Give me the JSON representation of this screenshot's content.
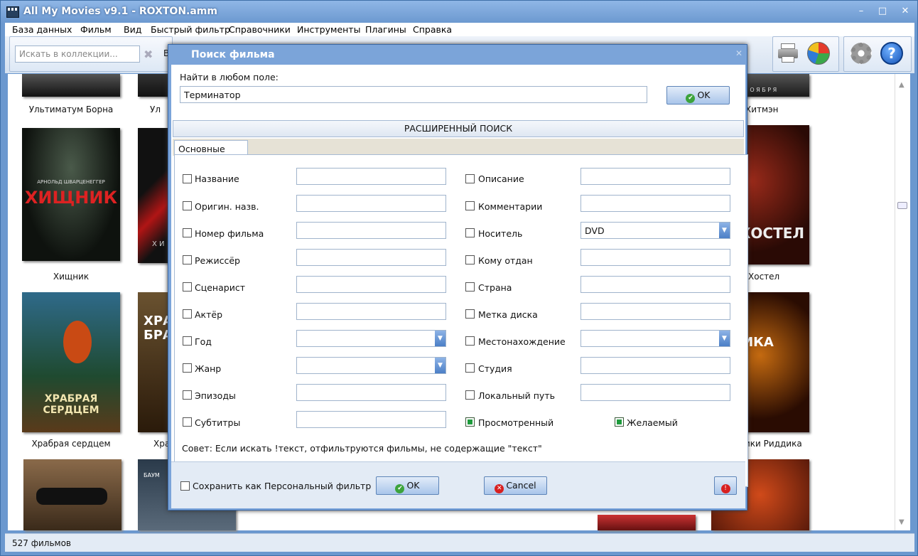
{
  "app": {
    "title": "All My Movies v9.1 - ROXTON.amm"
  },
  "window_controls": {
    "minimize": "–",
    "maximize": "□",
    "close": "✕"
  },
  "menu": [
    "База данных",
    "Фильм",
    "Вид",
    "Быстрый фильтр",
    "Справочники",
    "Инструменты",
    "Плагины",
    "Справка"
  ],
  "toolbar": {
    "search_placeholder": "Искать в коллекции...",
    "partial_label": "В"
  },
  "gallery": {
    "titles_row0": [
      "Ультиматум Борна",
      "Ул",
      "Хитмэн"
    ],
    "titles_row1": [
      "Хищник",
      "Хостел"
    ],
    "titles_row2": [
      "Храбрая сердцем",
      "Хра",
      "ики Риддика"
    ],
    "poster_text": {
      "p1a": "АРНОЛЬД ШВАРЦЕНЕГГЕР",
      "p1b": "ХИЩНИК",
      "p2": "Х И",
      "p3a": "ХРАБРАЯ",
      "p3b": "СЕРДЦЕМ",
      "p4a": "ХРА",
      "p4b": "БРА",
      "p5": "ХОСТЕЛ",
      "p6": "ДДИКА",
      "p7": "Н О Я Б Р Я",
      "p8": "БАУМ"
    }
  },
  "status": {
    "count": "527 фильмов"
  },
  "dialog": {
    "title": "Поиск фильма",
    "any_field_label": "Найти в любом поле:",
    "any_field_value": "Терминатор",
    "ok": "OK",
    "advanced": "РАСШИРЕННЫЙ ПОИСК",
    "tab": "Основные поля",
    "left_fields": [
      {
        "label": "Название",
        "checked": false,
        "type": "text",
        "value": ""
      },
      {
        "label": "Оригин. назв.",
        "checked": false,
        "type": "text",
        "value": ""
      },
      {
        "label": "Номер фильма",
        "checked": false,
        "type": "text",
        "value": ""
      },
      {
        "label": "Режиссёр",
        "checked": false,
        "type": "text",
        "value": ""
      },
      {
        "label": "Сценарист",
        "checked": false,
        "type": "text",
        "value": ""
      },
      {
        "label": "Актёр",
        "checked": false,
        "type": "text",
        "value": ""
      },
      {
        "label": "Год",
        "checked": false,
        "type": "select",
        "value": ""
      },
      {
        "label": "Жанр",
        "checked": false,
        "type": "select",
        "value": ""
      },
      {
        "label": "Эпизоды",
        "checked": false,
        "type": "text",
        "value": ""
      },
      {
        "label": "Субтитры",
        "checked": false,
        "type": "text",
        "value": ""
      }
    ],
    "right_fields": [
      {
        "label": "Описание",
        "checked": false,
        "type": "text",
        "value": ""
      },
      {
        "label": "Комментарии",
        "checked": false,
        "type": "text",
        "value": ""
      },
      {
        "label": "Носитель",
        "checked": false,
        "type": "select",
        "value": "DVD"
      },
      {
        "label": "Кому отдан",
        "checked": false,
        "type": "text",
        "value": ""
      },
      {
        "label": "Страна",
        "checked": false,
        "type": "text",
        "value": ""
      },
      {
        "label": "Метка диска",
        "checked": false,
        "type": "text",
        "value": ""
      },
      {
        "label": "Местонахождение",
        "checked": false,
        "type": "select",
        "value": ""
      },
      {
        "label": "Студия",
        "checked": false,
        "type": "text",
        "value": ""
      },
      {
        "label": "Локальный путь",
        "checked": false,
        "type": "text",
        "value": ""
      }
    ],
    "watched": {
      "label": "Просмотренный",
      "checked": true
    },
    "wanted": {
      "label": "Желаемый",
      "checked": true
    },
    "tip": "Совет: Если искать !текст, отфильтруются фильмы, не содержащие \"текст\"",
    "save_filter": "Сохранить как Персональный фильтр",
    "ok_bottom": "OK",
    "cancel": "Cancel",
    "reset_icon": "!"
  },
  "colors": {
    "accent": "#6b98cf",
    "checked": "#1e9b3c"
  }
}
